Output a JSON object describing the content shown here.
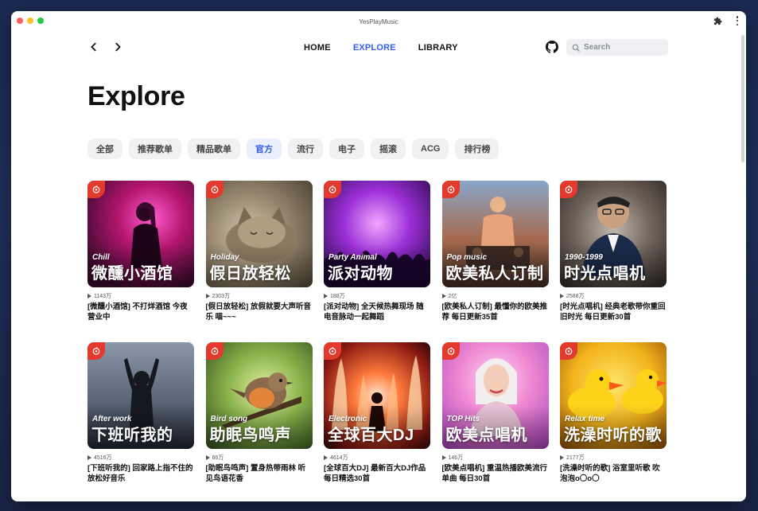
{
  "window": {
    "title": "YesPlayMusic"
  },
  "nav": {
    "links": [
      {
        "label": "HOME",
        "active": false
      },
      {
        "label": "EXPLORE",
        "active": true
      },
      {
        "label": "LIBRARY",
        "active": false
      }
    ],
    "search_placeholder": "Search"
  },
  "page": {
    "title": "Explore"
  },
  "categories": [
    {
      "label": "全部",
      "active": false
    },
    {
      "label": "推荐歌单",
      "active": false
    },
    {
      "label": "精品歌单",
      "active": false
    },
    {
      "label": "官方",
      "active": true
    },
    {
      "label": "流行",
      "active": false
    },
    {
      "label": "电子",
      "active": false
    },
    {
      "label": "摇滚",
      "active": false
    },
    {
      "label": "ACG",
      "active": false
    },
    {
      "label": "排行榜",
      "active": false
    }
  ],
  "playlists": [
    {
      "en": "Chill",
      "zh": "微醺小酒馆",
      "plays": "1143万",
      "desc": "[微醺小酒馆] 不打烊酒馆 今夜营业中"
    },
    {
      "en": "Holiday",
      "zh": "假日放轻松",
      "plays": "2303万",
      "desc": "[假日放轻松] 放假就要大声听音乐 喵~~~"
    },
    {
      "en": "Party Animal",
      "zh": "派对动物",
      "plays": "188万",
      "desc": "[派对动物] 全天候热舞现场 随电音脉动一起舞蹈"
    },
    {
      "en": "Pop music",
      "zh": "欧美私人订制",
      "plays": "2亿",
      "desc": "[欧美私人订制] 最懂你的欧美推荐 每日更新35首"
    },
    {
      "en": "1990-1999",
      "zh": "时光点唱机",
      "plays": "2588万",
      "desc": "[时光点唱机] 经典老歌带你重回旧时光 每日更新30首"
    },
    {
      "en": "After work",
      "zh": "下班听我的",
      "plays": "4516万",
      "desc": "[下班听我的] 回家路上指不住的放松好音乐"
    },
    {
      "en": "Bird song",
      "zh": "助眠鸟鸣声",
      "plays": "66万",
      "desc": "[助眠鸟鸣声] 置身热带雨林 听见鸟语花香"
    },
    {
      "en": "Electronic",
      "zh": "全球百大DJ",
      "plays": "4614万",
      "desc": "[全球百大DJ] 最新百大DJ作品 每日精选30首"
    },
    {
      "en": "TOP Hits",
      "zh": "欧美点唱机",
      "plays": "146万",
      "desc": "[欧美点唱机] 重温热播欧美流行单曲 每日30首"
    },
    {
      "en": "Relax time",
      "zh": "洗澡时听的歌",
      "plays": "2177万",
      "desc": "[洗澡时听的歌] 浴室里听歌 吹泡泡o〇o〇"
    }
  ],
  "colors": {
    "accent": "#335eea",
    "badge": "#e33a2d",
    "active_chip_bg": "#eaeffd"
  }
}
